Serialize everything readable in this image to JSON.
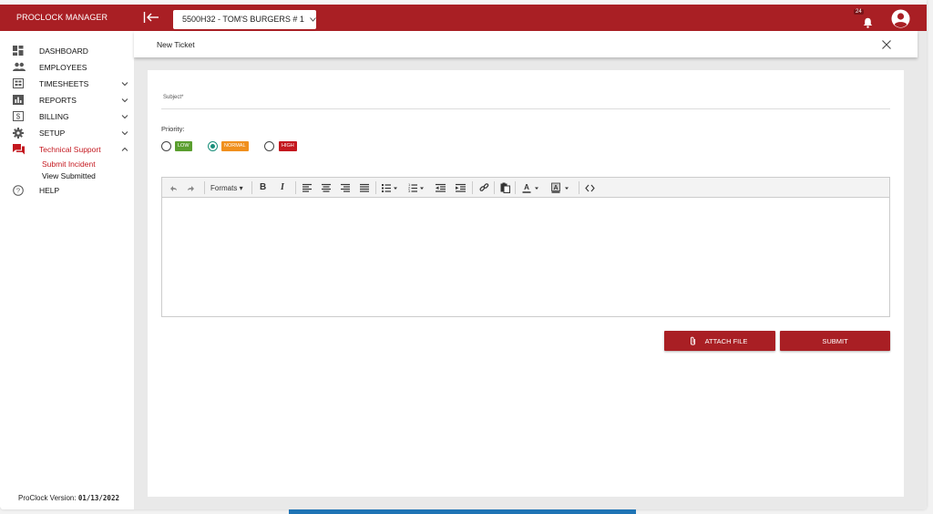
{
  "app": {
    "title": "PROCLOCK MANAGER",
    "store": "5500H32 - TOM'S BURGERS # 1",
    "notification_count": "24",
    "accent": "#a91f24"
  },
  "sidebar": {
    "items": [
      {
        "label": "DASHBOARD",
        "icon": "dashboard-icon"
      },
      {
        "label": "EMPLOYEES",
        "icon": "people-icon"
      },
      {
        "label": "TIMESHEETS",
        "icon": "timesheet-icon"
      },
      {
        "label": "REPORTS",
        "icon": "bar-chart-icon"
      },
      {
        "label": "BILLING",
        "icon": "dollar-icon"
      },
      {
        "label": "SETUP",
        "icon": "gear-icon"
      },
      {
        "label": "Technical Support",
        "icon": "chat-icon"
      },
      {
        "label": "HELP",
        "icon": "help-icon"
      }
    ],
    "sub_items": [
      {
        "label": "Submit Incident"
      },
      {
        "label": "View Submitted"
      }
    ],
    "version_label": "ProClock Version:",
    "version_value": "01/13/2022"
  },
  "ticket": {
    "title": "New Ticket",
    "subject_label": "Subject*",
    "priority_label": "Priority:",
    "priorities": [
      {
        "label": "LOW",
        "color": "#5a9e2f"
      },
      {
        "label": "NORMAL",
        "color": "#f0901e"
      },
      {
        "label": "HIGH",
        "color": "#c4181f"
      }
    ],
    "selected_priority": "NORMAL",
    "toolbar": {
      "formats": "Formats"
    },
    "attach_label": "ATTACH FILE",
    "submit_label": "SUBMIT"
  }
}
